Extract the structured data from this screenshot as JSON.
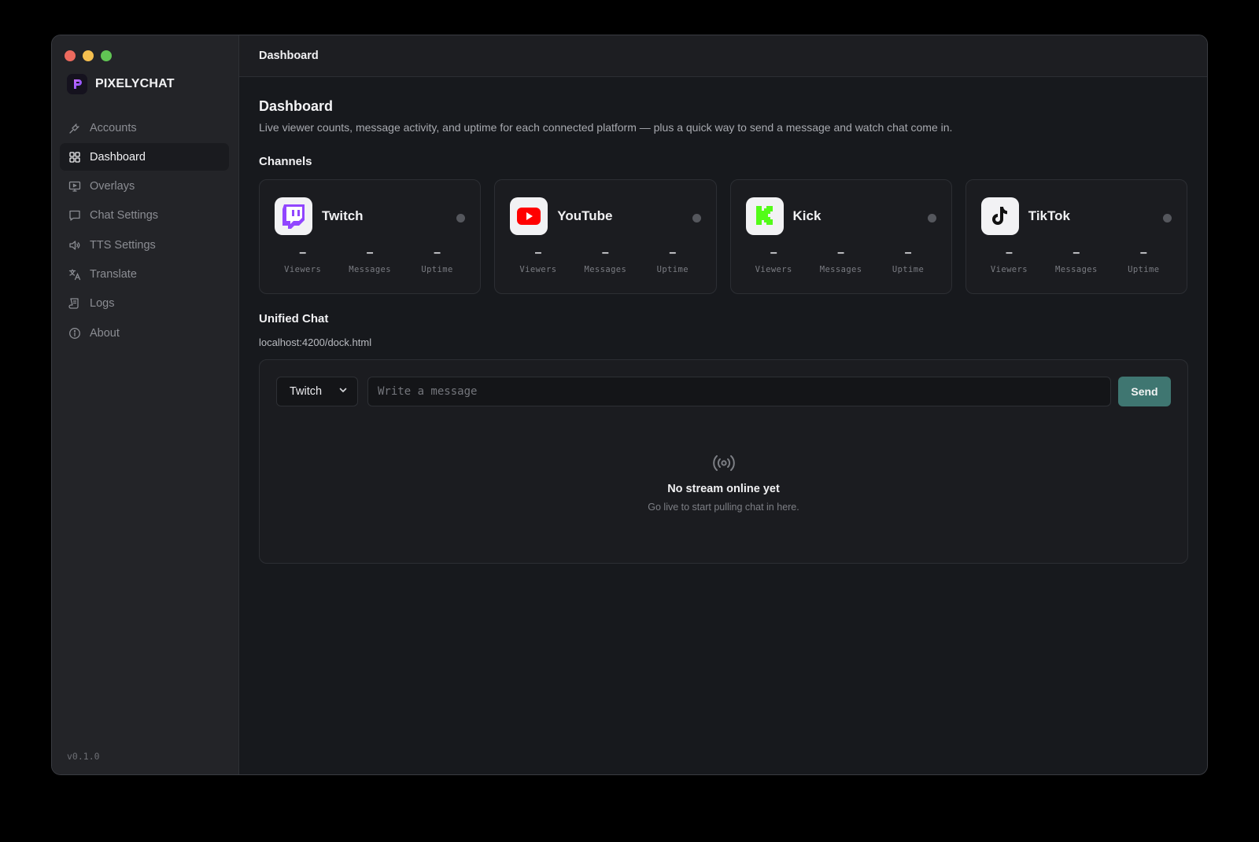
{
  "app": {
    "name": "PIXELYCHAT",
    "version": "v0.1.0"
  },
  "sidebar": {
    "items": [
      {
        "label": "Accounts",
        "icon": "plug-icon",
        "active": false
      },
      {
        "label": "Dashboard",
        "icon": "grid-icon",
        "active": true
      },
      {
        "label": "Overlays",
        "icon": "monitor-icon",
        "active": false
      },
      {
        "label": "Chat Settings",
        "icon": "chat-bubble-icon",
        "active": false
      },
      {
        "label": "TTS Settings",
        "icon": "speaker-icon",
        "active": false
      },
      {
        "label": "Translate",
        "icon": "translate-icon",
        "active": false
      },
      {
        "label": "Logs",
        "icon": "scroll-icon",
        "active": false
      },
      {
        "label": "About",
        "icon": "info-icon",
        "active": false
      }
    ]
  },
  "topbar": {
    "title": "Dashboard"
  },
  "main": {
    "title": "Dashboard",
    "description": "Live viewer counts, message activity, and uptime for each connected platform — plus a quick way to send a message and watch chat come in.",
    "channels_title": "Channels",
    "channels": [
      {
        "name": "Twitch",
        "icon": "twitch-icon",
        "viewers": "–",
        "messages": "–",
        "uptime": "–"
      },
      {
        "name": "YouTube",
        "icon": "youtube-icon",
        "viewers": "–",
        "messages": "–",
        "uptime": "–"
      },
      {
        "name": "Kick",
        "icon": "kick-icon",
        "viewers": "–",
        "messages": "–",
        "uptime": "–"
      },
      {
        "name": "TikTok",
        "icon": "tiktok-icon",
        "viewers": "–",
        "messages": "–",
        "uptime": "–"
      }
    ],
    "stat_labels": {
      "viewers": "Viewers",
      "messages": "Messages",
      "uptime": "Uptime"
    },
    "unified_title": "Unified Chat",
    "dock_url": "localhost:4200/dock.html",
    "chat": {
      "platform_selected": "Twitch",
      "input_placeholder": "Write a message",
      "send_label": "Send",
      "empty_title": "No stream online yet",
      "empty_subtitle": "Go live to start pulling chat in here."
    }
  },
  "colors": {
    "accent": "#3f7671",
    "twitch": "#9146ff",
    "youtube": "#ff0000",
    "kick": "#53fc18",
    "status_offline": "#55575d"
  }
}
